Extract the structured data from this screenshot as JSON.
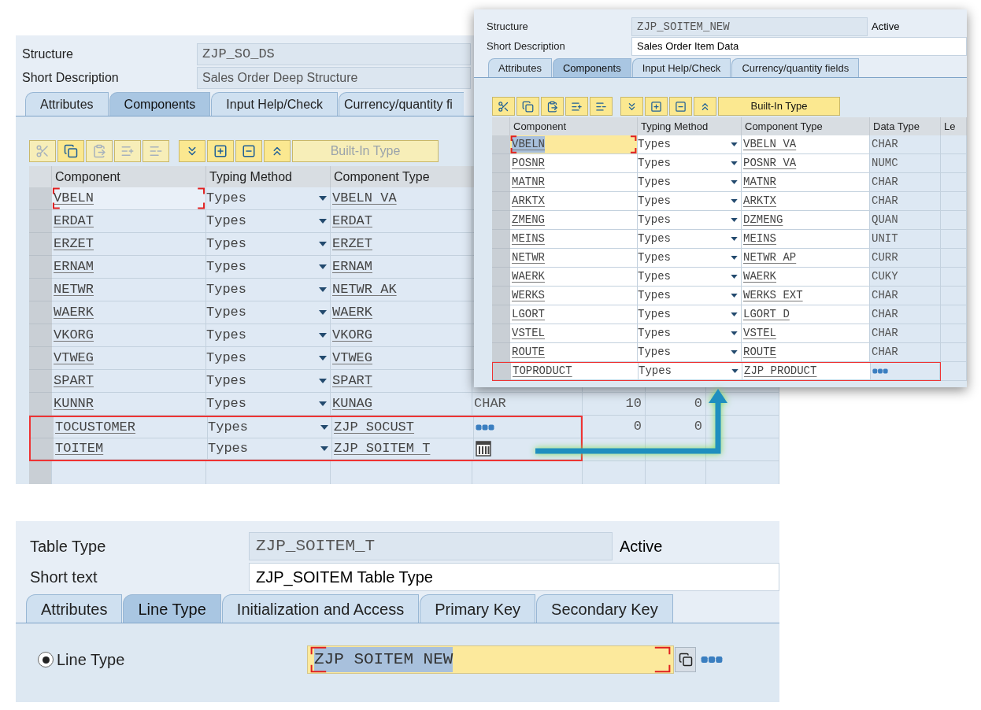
{
  "deep_structure": {
    "header_fields": [
      {
        "label": "Structure",
        "value": "ZJP_SO_DS",
        "kind": "code",
        "editable": false
      },
      {
        "label": "Short Description",
        "value": "Sales Order Deep Structure",
        "kind": "text",
        "editable": false
      }
    ],
    "tabs": [
      {
        "label": "Attributes",
        "selected": false
      },
      {
        "label": "Components",
        "selected": true
      },
      {
        "label": "Input Help/Check",
        "selected": false
      },
      {
        "label": "Currency/quantity fi",
        "selected": false
      }
    ],
    "toolbar": [
      {
        "kind": "cut",
        "disabled": true
      },
      {
        "kind": "copy",
        "disabled": false
      },
      {
        "kind": "paste",
        "disabled": true
      },
      {
        "kind": "insert_row",
        "disabled": true
      },
      {
        "kind": "delete_row",
        "disabled": true
      },
      {
        "kind": "scroll_down",
        "disabled": false
      },
      {
        "kind": "insert",
        "disabled": false
      },
      {
        "kind": "delete",
        "disabled": false
      },
      {
        "kind": "scroll_up",
        "disabled": false
      }
    ],
    "builtin_button": {
      "label": "Built-In Type",
      "disabled": true
    },
    "table": {
      "edit_mode": false,
      "columns": [
        "Component",
        "Typing Method",
        "Component Type"
      ],
      "rows": [
        {
          "kind": "elementary",
          "component": "VBELN",
          "typing": "Types",
          "component_type": "VBELN VA",
          "focused": true,
          "highlighted": false
        },
        {
          "kind": "elementary",
          "component": "ERDAT",
          "typing": "Types",
          "component_type": "ERDAT",
          "focused": false,
          "highlighted": false
        },
        {
          "kind": "elementary",
          "component": "ERZET",
          "typing": "Types",
          "component_type": "ERZET",
          "focused": false,
          "highlighted": false
        },
        {
          "kind": "elementary",
          "component": "ERNAM",
          "typing": "Types",
          "component_type": "ERNAM",
          "focused": false,
          "highlighted": false
        },
        {
          "kind": "elementary",
          "component": "NETWR",
          "typing": "Types",
          "component_type": "NETWR AK",
          "focused": false,
          "highlighted": false
        },
        {
          "kind": "elementary",
          "component": "WAERK",
          "typing": "Types",
          "component_type": "WAERK",
          "focused": false,
          "highlighted": false
        },
        {
          "kind": "elementary",
          "component": "VKORG",
          "typing": "Types",
          "component_type": "VKORG",
          "focused": false,
          "highlighted": false
        },
        {
          "kind": "elementary",
          "component": "VTWEG",
          "typing": "Types",
          "component_type": "VTWEG",
          "focused": false,
          "highlighted": false
        },
        {
          "kind": "elementary",
          "component": "SPART",
          "typing": "Types",
          "component_type": "SPART",
          "focused": false,
          "highlighted": false
        },
        {
          "kind": "elementary",
          "component": "KUNNR",
          "typing": "Types",
          "component_type": "KUNAG",
          "data_type": "CHAR",
          "length": "10",
          "decimals": "0",
          "focused": false,
          "highlighted": false
        },
        {
          "kind": "structure",
          "component": "TOCUSTOMER",
          "typing": "Types",
          "component_type": "ZJP SOCUST",
          "length": "0",
          "decimals": "0",
          "focused": false,
          "highlighted": true
        },
        {
          "kind": "table",
          "component": "TOITEM",
          "typing": "Types",
          "component_type": "ZJP SOITEM T",
          "focused": false,
          "highlighted": true
        }
      ]
    }
  },
  "item_structure": {
    "header_fields": [
      {
        "label": "Structure",
        "value": "ZJP_SOITEM_NEW",
        "kind": "code",
        "editable": false,
        "status": "Active"
      },
      {
        "label": "Short Description",
        "value": "Sales Order Item Data",
        "kind": "text",
        "editable": true
      }
    ],
    "tabs": [
      {
        "label": "Attributes",
        "selected": false
      },
      {
        "label": "Components",
        "selected": true
      },
      {
        "label": "Input Help/Check",
        "selected": false
      },
      {
        "label": "Currency/quantity fields",
        "selected": false
      }
    ],
    "toolbar": [
      {
        "kind": "cut",
        "disabled": false
      },
      {
        "kind": "copy",
        "disabled": false
      },
      {
        "kind": "paste",
        "disabled": false
      },
      {
        "kind": "insert_row",
        "disabled": false
      },
      {
        "kind": "delete_row",
        "disabled": false
      },
      {
        "kind": "scroll_down",
        "disabled": false
      },
      {
        "kind": "insert",
        "disabled": false
      },
      {
        "kind": "delete",
        "disabled": false
      },
      {
        "kind": "scroll_up",
        "disabled": false
      }
    ],
    "builtin_button": {
      "label": "Built-In Type",
      "disabled": false
    },
    "table": {
      "edit_mode": true,
      "columns": [
        "Component",
        "Typing Method",
        "Component Type",
        "Data Type",
        "Le"
      ],
      "rows": [
        {
          "kind": "elementary",
          "component": "VBELN",
          "typing": "Types",
          "component_type": "VBELN VA",
          "data_type": "CHAR",
          "focused": true,
          "highlighted": false
        },
        {
          "kind": "elementary",
          "component": "POSNR",
          "typing": "Types",
          "component_type": "POSNR VA",
          "data_type": "NUMC",
          "focused": false,
          "highlighted": false
        },
        {
          "kind": "elementary",
          "component": "MATNR",
          "typing": "Types",
          "component_type": "MATNR",
          "data_type": "CHAR",
          "focused": false,
          "highlighted": false
        },
        {
          "kind": "elementary",
          "component": "ARKTX",
          "typing": "Types",
          "component_type": "ARKTX",
          "data_type": "CHAR",
          "focused": false,
          "highlighted": false
        },
        {
          "kind": "elementary",
          "component": "ZMENG",
          "typing": "Types",
          "component_type": "DZMENG",
          "data_type": "QUAN",
          "focused": false,
          "highlighted": false
        },
        {
          "kind": "elementary",
          "component": "MEINS",
          "typing": "Types",
          "component_type": "MEINS",
          "data_type": "UNIT",
          "focused": false,
          "highlighted": false
        },
        {
          "kind": "elementary",
          "component": "NETWR",
          "typing": "Types",
          "component_type": "NETWR AP",
          "data_type": "CURR",
          "focused": false,
          "highlighted": false
        },
        {
          "kind": "elementary",
          "component": "WAERK",
          "typing": "Types",
          "component_type": "WAERK",
          "data_type": "CUKY",
          "focused": false,
          "highlighted": false
        },
        {
          "kind": "elementary",
          "component": "WERKS",
          "typing": "Types",
          "component_type": "WERKS EXT",
          "data_type": "CHAR",
          "focused": false,
          "highlighted": false
        },
        {
          "kind": "elementary",
          "component": "LGORT",
          "typing": "Types",
          "component_type": "LGORT D",
          "data_type": "CHAR",
          "focused": false,
          "highlighted": false
        },
        {
          "kind": "elementary",
          "component": "VSTEL",
          "typing": "Types",
          "component_type": "VSTEL",
          "data_type": "CHAR",
          "focused": false,
          "highlighted": false
        },
        {
          "kind": "elementary",
          "component": "ROUTE",
          "typing": "Types",
          "component_type": "ROUTE",
          "data_type": "CHAR",
          "focused": false,
          "highlighted": false
        },
        {
          "kind": "structure",
          "component": "TOPRODUCT",
          "typing": "Types",
          "component_type": "ZJP PRODUCT",
          "focused": false,
          "highlighted": true
        }
      ]
    }
  },
  "table_type": {
    "header_fields": [
      {
        "label": "Table Type",
        "value": "ZJP_SOITEM_T",
        "kind": "code",
        "editable": false,
        "status": "Active"
      },
      {
        "label": "Short text",
        "value": "ZJP_SOITEM Table Type",
        "kind": "text",
        "editable": true
      }
    ],
    "tabs": [
      {
        "label": "Attributes",
        "selected": false
      },
      {
        "label": "Line Type",
        "selected": true
      },
      {
        "label": "Initialization and Access",
        "selected": false
      },
      {
        "label": "Primary Key",
        "selected": false
      },
      {
        "label": "Secondary Key",
        "selected": false
      }
    ],
    "line_type": {
      "kind": "structure",
      "label": "Line Type",
      "selected": true,
      "value": "ZJP SOITEM NEW",
      "focused": true
    }
  }
}
